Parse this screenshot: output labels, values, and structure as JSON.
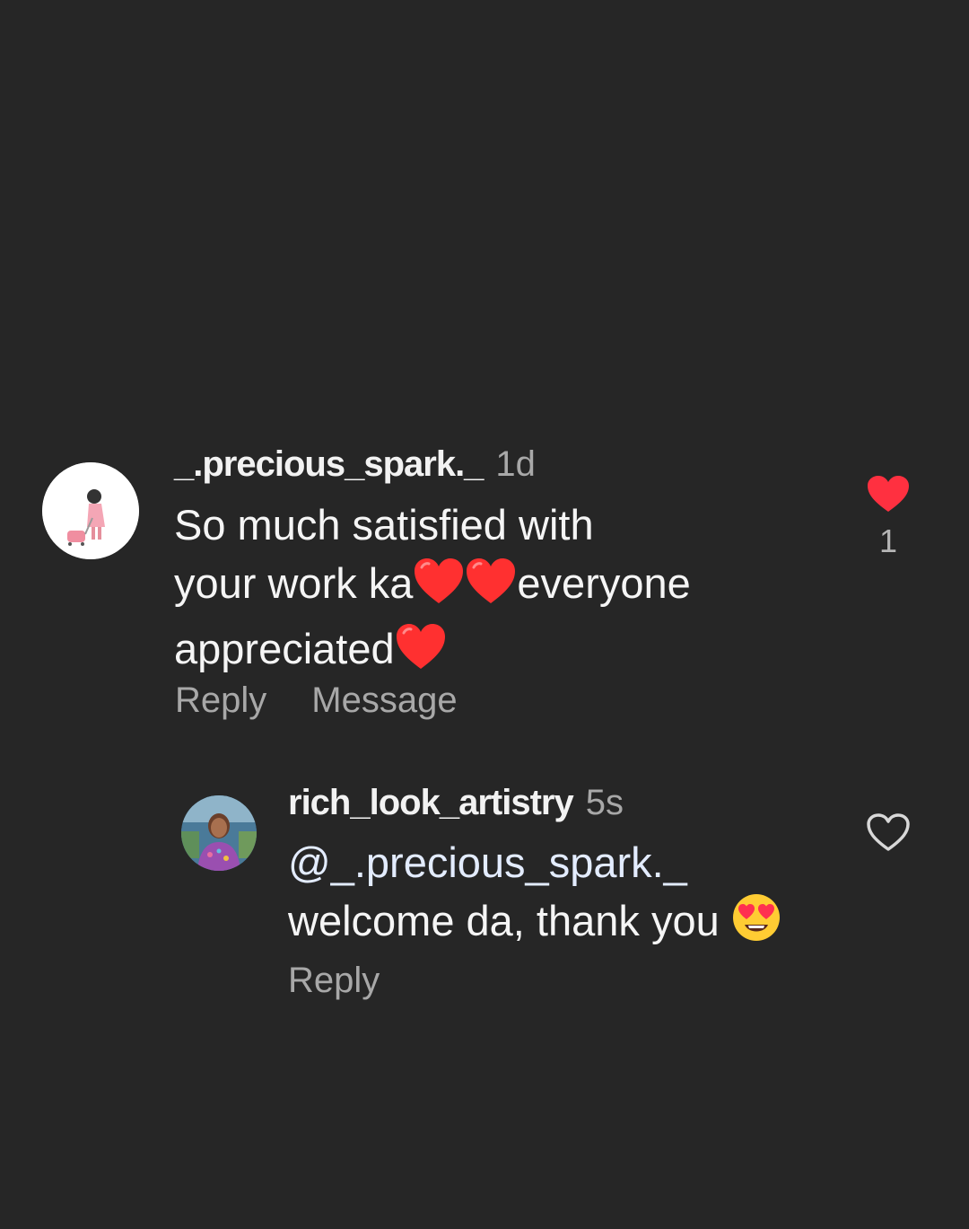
{
  "comments": [
    {
      "username": "_.precious_spark._",
      "time": "1d",
      "text_line1": "So much satisfied with",
      "text_line2_a": "your work ka",
      "text_line2_b": "everyone",
      "text_line3": "appreciated",
      "reply_label": "Reply",
      "message_label": "Message",
      "likes": "1",
      "liked": true
    },
    {
      "username": "rich_look_artistry",
      "time": "5s",
      "mention": "@_.precious_spark._",
      "text_line2": "welcome da, thank you ",
      "reply_label": "Reply",
      "liked": false
    }
  ],
  "colors": {
    "background": "#262626",
    "like_red": "#ff3040",
    "secondary_text": "#a8a8a8"
  }
}
